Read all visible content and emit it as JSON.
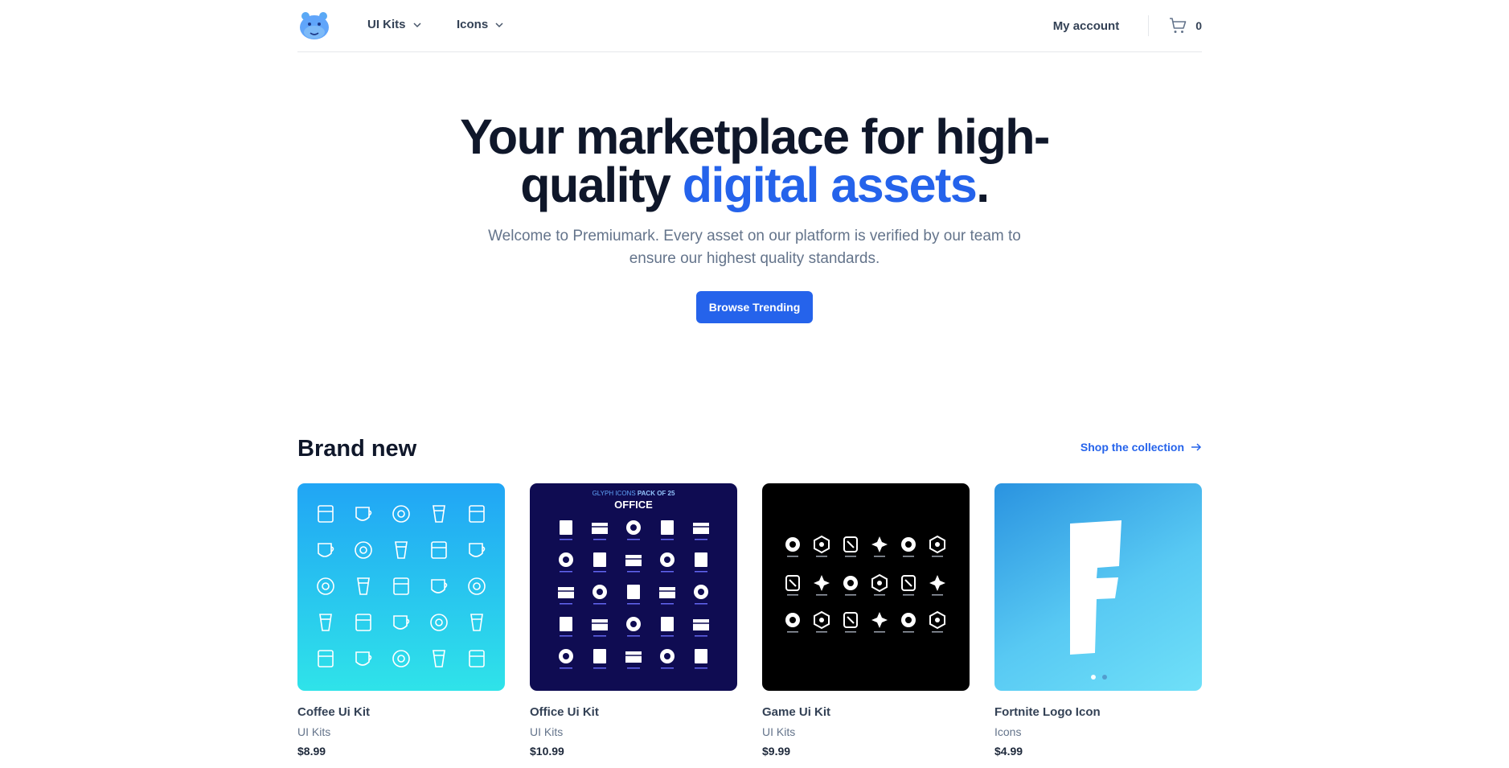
{
  "nav": {
    "menu": [
      {
        "label": "UI Kits"
      },
      {
        "label": "Icons"
      }
    ],
    "account_label": "My account",
    "cart_count": "0"
  },
  "hero": {
    "title_part1": "Your marketplace for high-quality ",
    "title_accent": "digital assets",
    "title_end": ".",
    "subtitle": "Welcome to Premiumark. Every asset on our platform is verified by our team to ensure our highest quality standards.",
    "cta_label": "Browse Trending"
  },
  "section": {
    "title": "Brand new",
    "link_label": "Shop the collection"
  },
  "products": [
    {
      "name": "Coffee Ui Kit",
      "category": "UI Kits",
      "price": "$8.99"
    },
    {
      "name": "Office Ui Kit",
      "category": "UI Kits",
      "price": "$10.99",
      "image_heading_1": "GLYPH ICONS",
      "image_heading_2": "PACK OF 25",
      "image_heading_3": "OFFICE"
    },
    {
      "name": "Game Ui Kit",
      "category": "UI Kits",
      "price": "$9.99"
    },
    {
      "name": "Fortnite Logo Icon",
      "category": "Icons",
      "price": "$4.99"
    }
  ],
  "colors": {
    "accent": "#2563eb",
    "heading": "#0f172a",
    "muted": "#64748b"
  }
}
